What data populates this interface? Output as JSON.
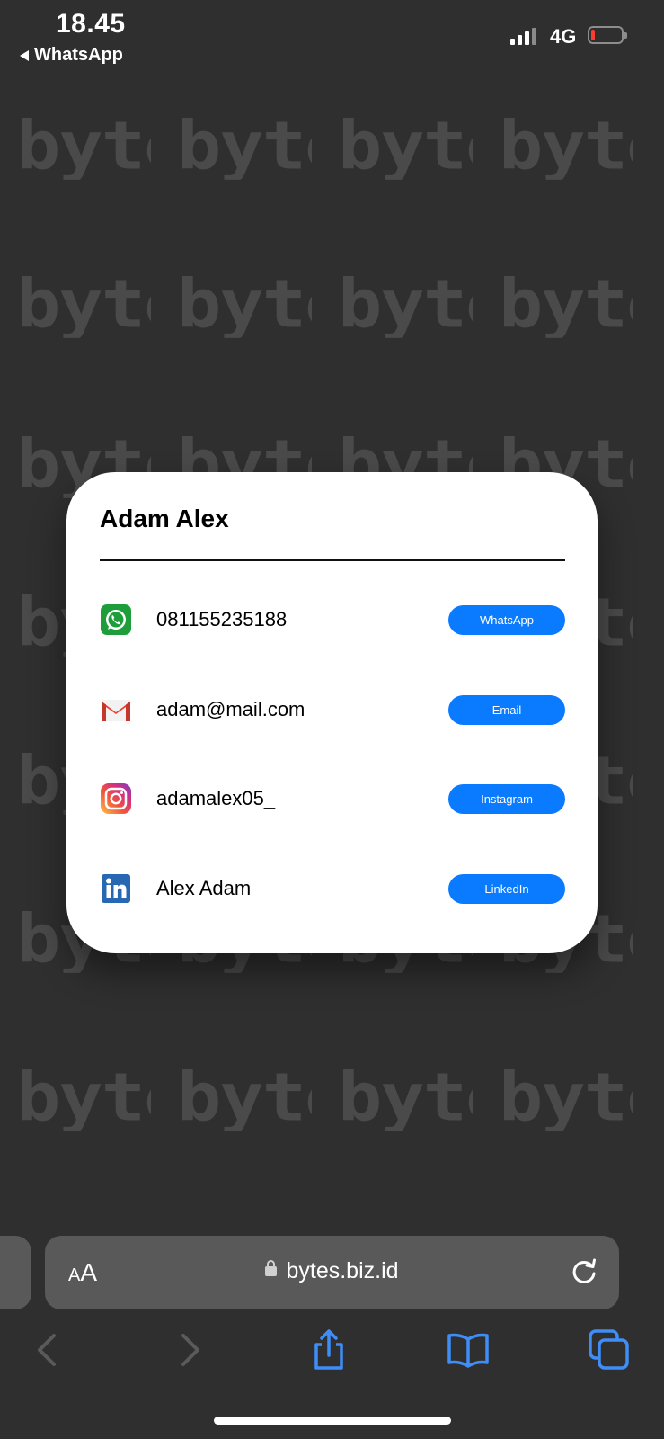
{
  "status_bar": {
    "time": "18.45",
    "back_app": "WhatsApp",
    "network": "4G",
    "battery_level": 0.1
  },
  "watermark": {
    "text": "bytes"
  },
  "card": {
    "title": "Adam Alex",
    "rows": [
      {
        "icon": "whatsapp-icon",
        "text": "081155235188",
        "button": "WhatsApp"
      },
      {
        "icon": "gmail-icon",
        "text": "adam@mail.com",
        "button": "Email"
      },
      {
        "icon": "instagram-icon",
        "text": "adamalex05_",
        "button": "Instagram"
      },
      {
        "icon": "linkedin-icon",
        "text": "Alex Adam",
        "button": "LinkedIn"
      }
    ]
  },
  "safari": {
    "text_size_label_small": "A",
    "text_size_label_large": "A",
    "url": "bytes.biz.id",
    "toolbar_icons": [
      "back-icon",
      "forward-icon",
      "share-icon",
      "bookmarks-icon",
      "tabs-icon"
    ]
  },
  "colors": {
    "button": "#0a7aff",
    "background": "#2f2f2f",
    "card": "#ffffff"
  }
}
